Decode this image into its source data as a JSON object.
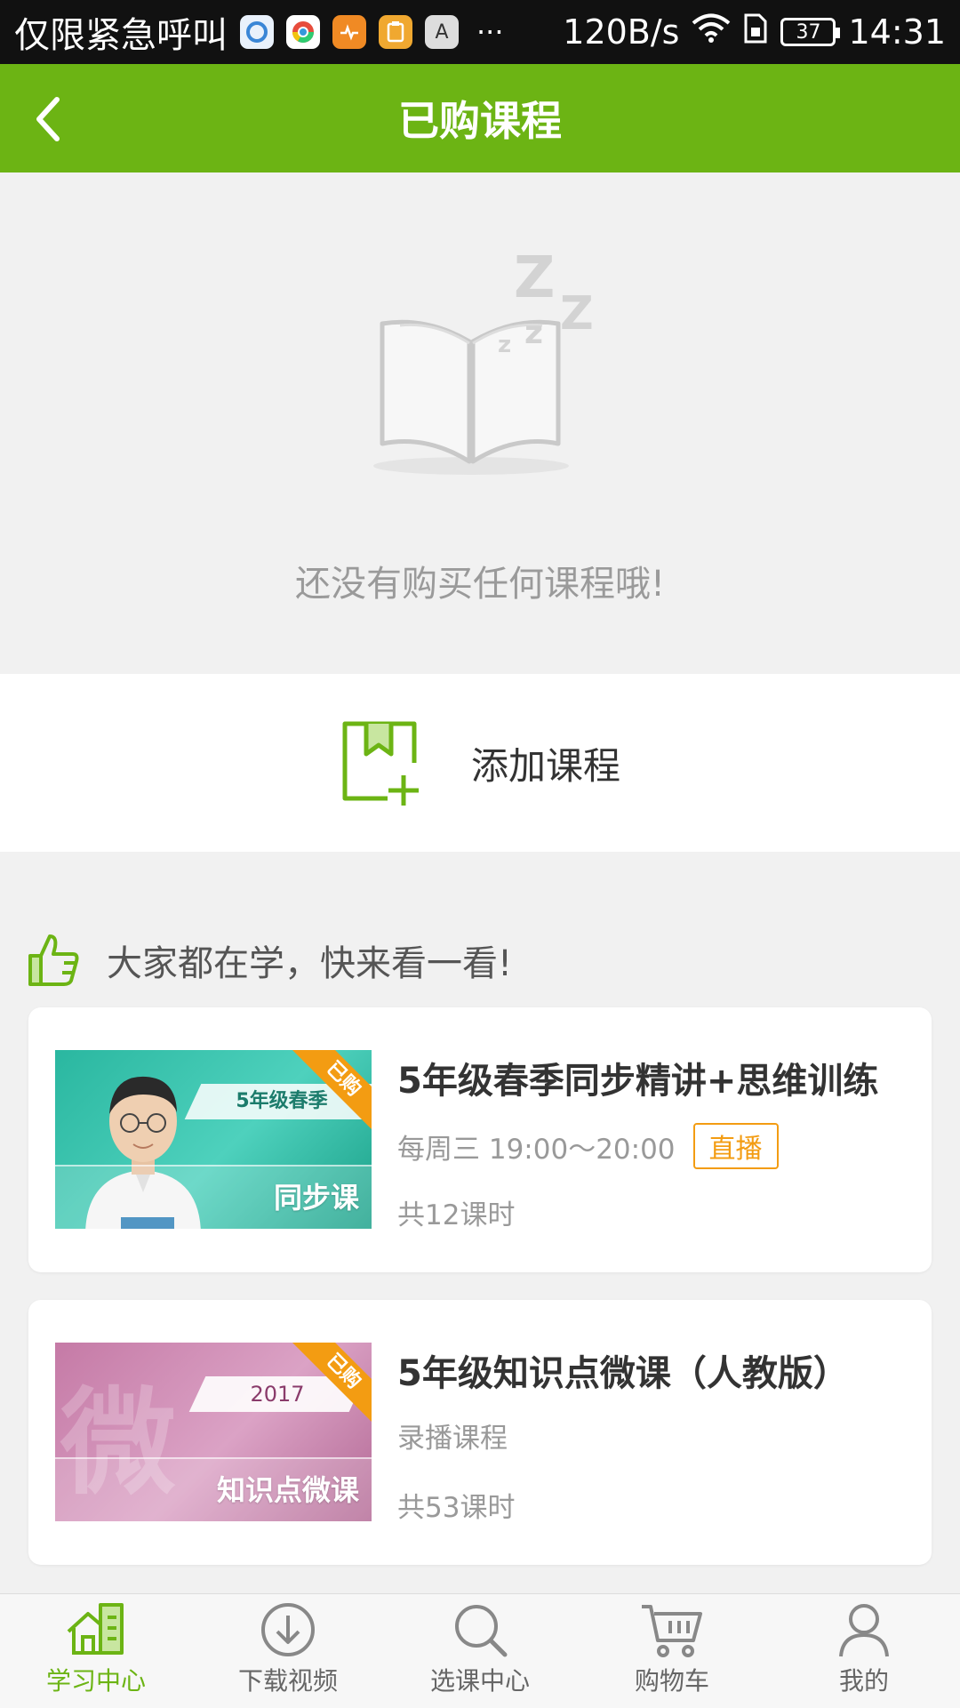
{
  "status_bar": {
    "carrier": "仅限紧急呼叫",
    "app_icons": [
      "browser-icon",
      "chrome-icon",
      "health-icon",
      "clipboard-icon",
      "font-icon"
    ],
    "font_icon_letter": "A",
    "more": "···",
    "speed": "120B/s",
    "battery": "37",
    "time": "14:31"
  },
  "nav": {
    "title": "已购课程"
  },
  "empty_state": {
    "message": "还没有购买任何课程哦!"
  },
  "add_course": {
    "label": "添加课程"
  },
  "recommend": {
    "header": "大家都在学，快来看一看!"
  },
  "courses": [
    {
      "title": "5年级春季同步精讲+思维训练",
      "schedule": "每周三 19:00～20:00",
      "badge": "直播",
      "lessons": "共12课时",
      "thumb_grade": "5年级春季",
      "thumb_label": "同步课",
      "ribbon": "已购"
    },
    {
      "title": "5年级知识点微课（人教版）",
      "schedule": "录播课程",
      "lessons": "共53课时",
      "thumb_year": "2017",
      "thumb_label": "知识点微课",
      "thumb_bg_char": "微",
      "ribbon": "已购"
    }
  ],
  "tabs": [
    {
      "label": "学习中心",
      "icon": "home-icon",
      "active": true
    },
    {
      "label": "下载视频",
      "icon": "download-icon",
      "active": false
    },
    {
      "label": "选课中心",
      "icon": "search-icon",
      "active": false
    },
    {
      "label": "购物车",
      "icon": "cart-icon",
      "active": false
    },
    {
      "label": "我的",
      "icon": "user-icon",
      "active": false
    }
  ],
  "colors": {
    "primary": "#6cb414",
    "accent_orange": "#f39c12",
    "text_dark": "#333333",
    "text_muted": "#999999"
  }
}
